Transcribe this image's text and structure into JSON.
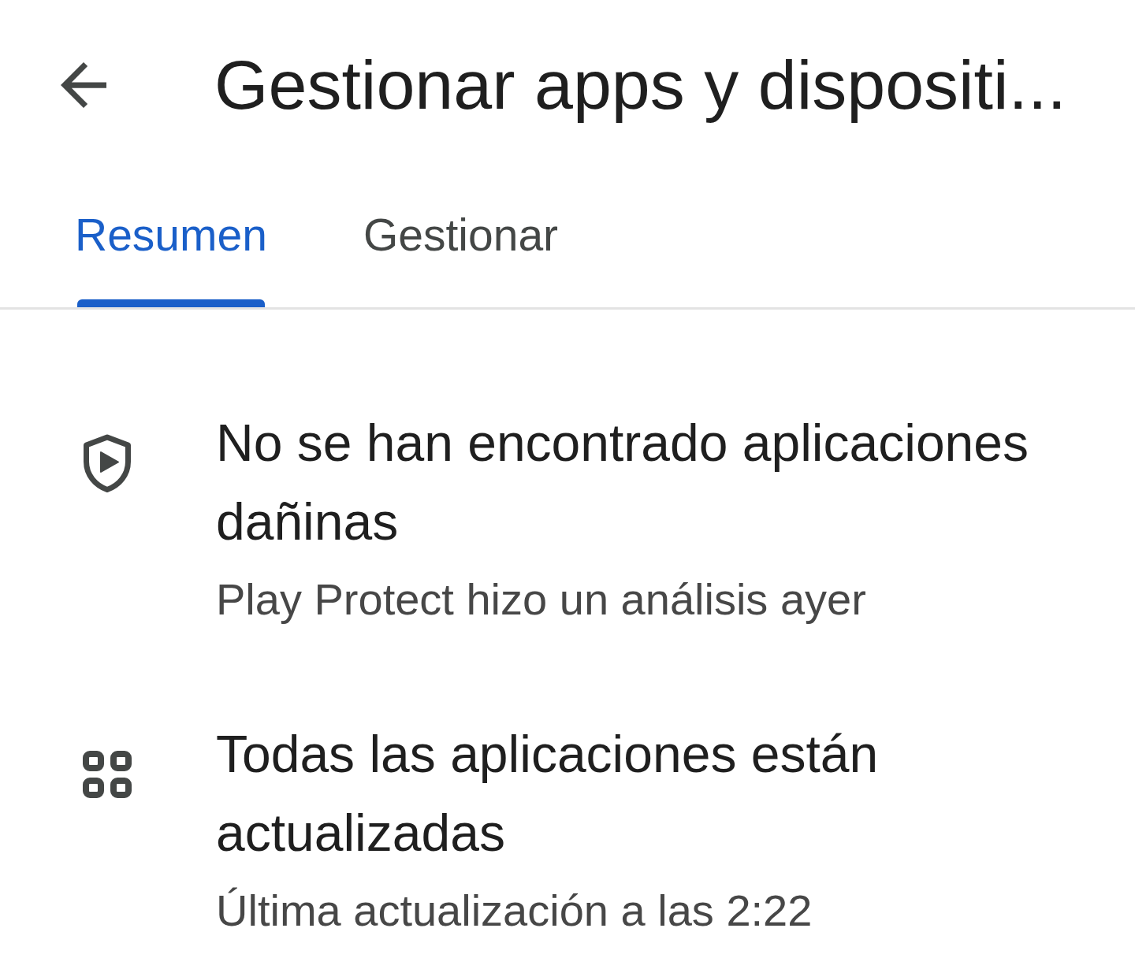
{
  "header": {
    "title": "Gestionar apps y dispositi..."
  },
  "tabs": [
    {
      "label": "Resumen",
      "selected": true
    },
    {
      "label": "Gestionar",
      "selected": false
    }
  ],
  "items": [
    {
      "kind": "shield",
      "title": "No se han encontrado aplicaciones dañinas",
      "subtitle": "Play Protect hizo un análisis ayer"
    },
    {
      "kind": "apps",
      "title": "Todas las aplicaciones están actualizadas",
      "subtitle": "Última actualización a las 2:22"
    }
  ]
}
